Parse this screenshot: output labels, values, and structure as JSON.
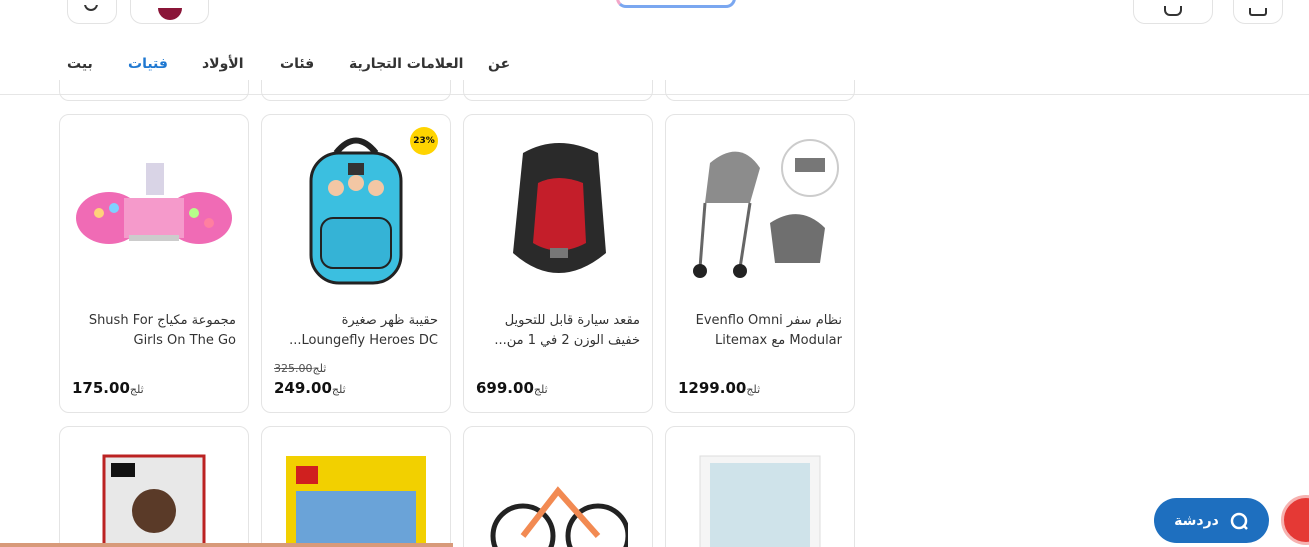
{
  "nav": {
    "items": [
      "بيت",
      "فتيات",
      "الأولاد",
      "فئات",
      "العلامات التجارية",
      "عن"
    ],
    "active_index": 1
  },
  "chat": {
    "label": "دردشة"
  },
  "currency": "ثلج",
  "products": [
    {
      "title": "مجموعة مكياج Shush For Girls On The Go",
      "price": "175.00"
    },
    {
      "title": "حقيبة ظهر صغيرة Loungefly Heroes DC...",
      "old_price": "325.00",
      "price": "249.00",
      "badge": "23%"
    },
    {
      "title": "مقعد سيارة قابل للتحويل خفيف الوزن 2 في 1 من...",
      "price": "699.00"
    },
    {
      "title": "نظام سفر Evenflo Omni Modular مع Litemax",
      "price": "1299.00"
    }
  ],
  "colors": {
    "accent": "#1f78d1",
    "chat": "#1e6fbf",
    "badge": "#ffd400"
  }
}
